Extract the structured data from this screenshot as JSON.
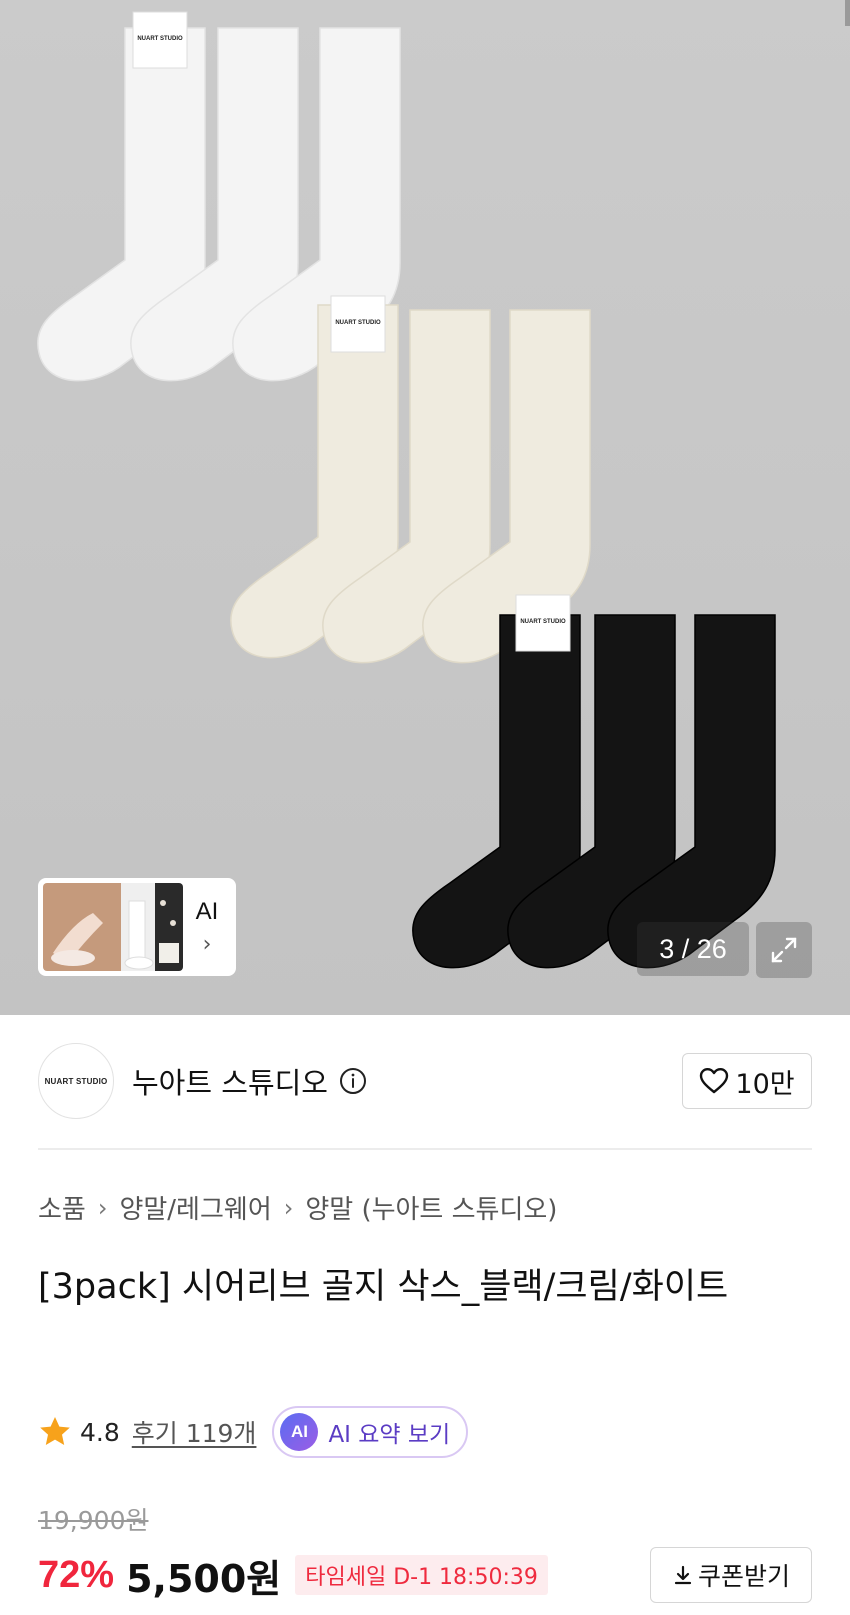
{
  "gallery": {
    "tag_text": "NUART STUDIO",
    "page_counter": "3 / 26",
    "ai_label": "AI",
    "ai_chevron": "›"
  },
  "brand": {
    "logo_text": "NUART STUDIO",
    "name": "누아트 스튜디오",
    "like_count": "10만"
  },
  "breadcrumb": {
    "items": [
      "소품",
      "양말/레그웨어",
      "양말 (누아트 스튜디오)"
    ],
    "separator": "›"
  },
  "product": {
    "title": "[3pack] 시어리브 골지 삭스_블랙/크림/화이트",
    "rating": "4.8",
    "review_link": "후기 119개",
    "ai_badge": "AI",
    "ai_summary_label": "AI 요약 보기"
  },
  "price": {
    "original": "19,900원",
    "discount_rate": "72%",
    "sale_price": "5,500원",
    "timesale": "타임세일 D-1 18:50:39",
    "coupon_label": "쿠폰받기"
  },
  "colors": {
    "accent_red": "#f0263d",
    "ai_purple": "#5b3cc4",
    "star_orange": "#f7a21b",
    "background_gray": "#c8c8c8"
  },
  "icons": [
    "info-icon",
    "heart-icon",
    "star-icon",
    "download-icon",
    "expand-icon",
    "chevron-right-icon"
  ]
}
